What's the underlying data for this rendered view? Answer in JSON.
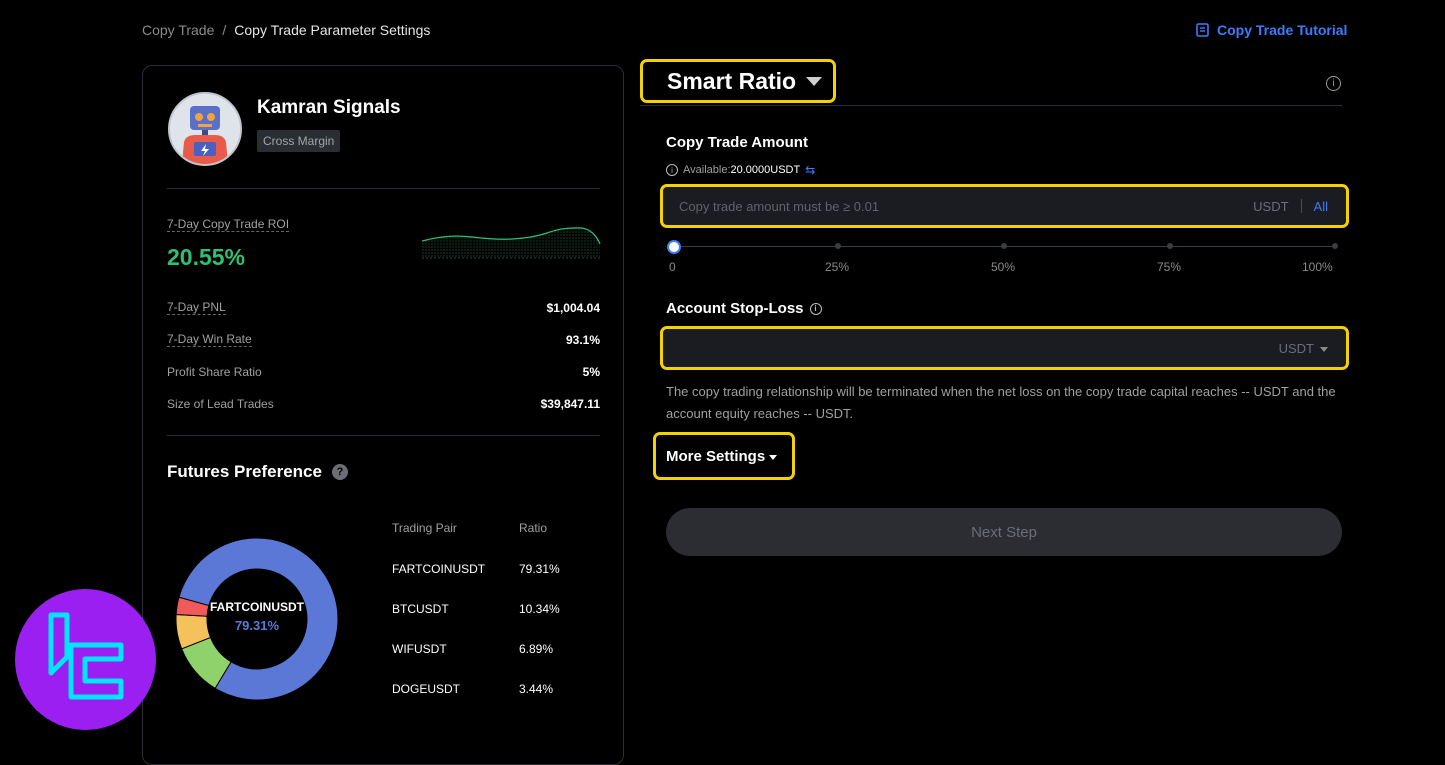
{
  "breadcrumb": {
    "parent": "Copy Trade",
    "separator": "/",
    "current": "Copy Trade Parameter Settings"
  },
  "tutorial": {
    "label": "Copy Trade Tutorial",
    "icon": "book-icon"
  },
  "trader": {
    "name": "Kamran Signals",
    "tag": "Cross Margin",
    "roi_label": "7-Day Copy Trade ROI",
    "roi_value": "20.55%",
    "stats": [
      {
        "label": "7-Day PNL",
        "value": "$1,004.04"
      },
      {
        "label": "7-Day Win Rate",
        "value": "93.1%"
      },
      {
        "label": "Profit Share Ratio",
        "value": "5%"
      },
      {
        "label": "Size of Lead Trades",
        "value": "$39,847.11"
      }
    ]
  },
  "futures_preference": {
    "title": "Futures Preference",
    "center_pair": "FARTCOINUSDT",
    "center_ratio": "79.31%",
    "headers": {
      "pair": "Trading Pair",
      "ratio": "Ratio"
    },
    "rows": [
      {
        "pair": "FARTCOINUSDT",
        "ratio": "79.31%",
        "value": 79.31,
        "color": "#5b78d6"
      },
      {
        "pair": "BTCUSDT",
        "ratio": "10.34%",
        "value": 10.34,
        "color": "#8fd16a"
      },
      {
        "pair": "WIFUSDT",
        "ratio": "6.89%",
        "value": 6.89,
        "color": "#f5c15a"
      },
      {
        "pair": "DOGEUSDT",
        "ratio": "3.44%",
        "value": 3.44,
        "color": "#f05a5a"
      }
    ]
  },
  "mode": {
    "label": "Smart Ratio"
  },
  "copy_amount": {
    "title": "Copy Trade Amount",
    "available_label": "Available:",
    "available_value": "20.0000USDT",
    "placeholder": "Copy trade amount must be ≥ 0.01",
    "unit": "USDT",
    "all_label": "All",
    "slider_labels": [
      "0",
      "25%",
      "50%",
      "75%",
      "100%"
    ],
    "slider_percent": 0
  },
  "stop_loss": {
    "title": "Account Stop-Loss",
    "unit": "USDT",
    "description": "The copy trading relationship will be terminated when the net loss on the copy trade capital reaches -- USDT and the account equity reaches -- USDT."
  },
  "more_settings": {
    "label": "More Settings"
  },
  "next_step": {
    "label": "Next Step"
  },
  "colors": {
    "accent": "#3d7bff",
    "highlight": "#f4d100",
    "positive": "#2fbf71"
  }
}
